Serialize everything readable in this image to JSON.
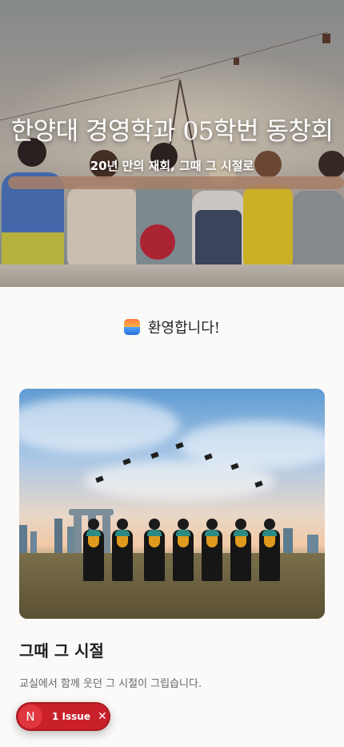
{
  "hero": {
    "title": "한양대 경영학과 05학번 동창회",
    "subtitle": "20년 만의 재회, 그때 그 시절로"
  },
  "welcome": {
    "icon": "sunset-emoji-icon",
    "text": "환영합니다!"
  },
  "card": {
    "title": "그때 그 시절",
    "description": "교실에서 함께 웃던 그 시절이 그립습니다."
  },
  "issue_badge": {
    "avatar_letter": "N",
    "label": "1 Issue",
    "close_symbol": "✕",
    "color": "#c9202a"
  }
}
